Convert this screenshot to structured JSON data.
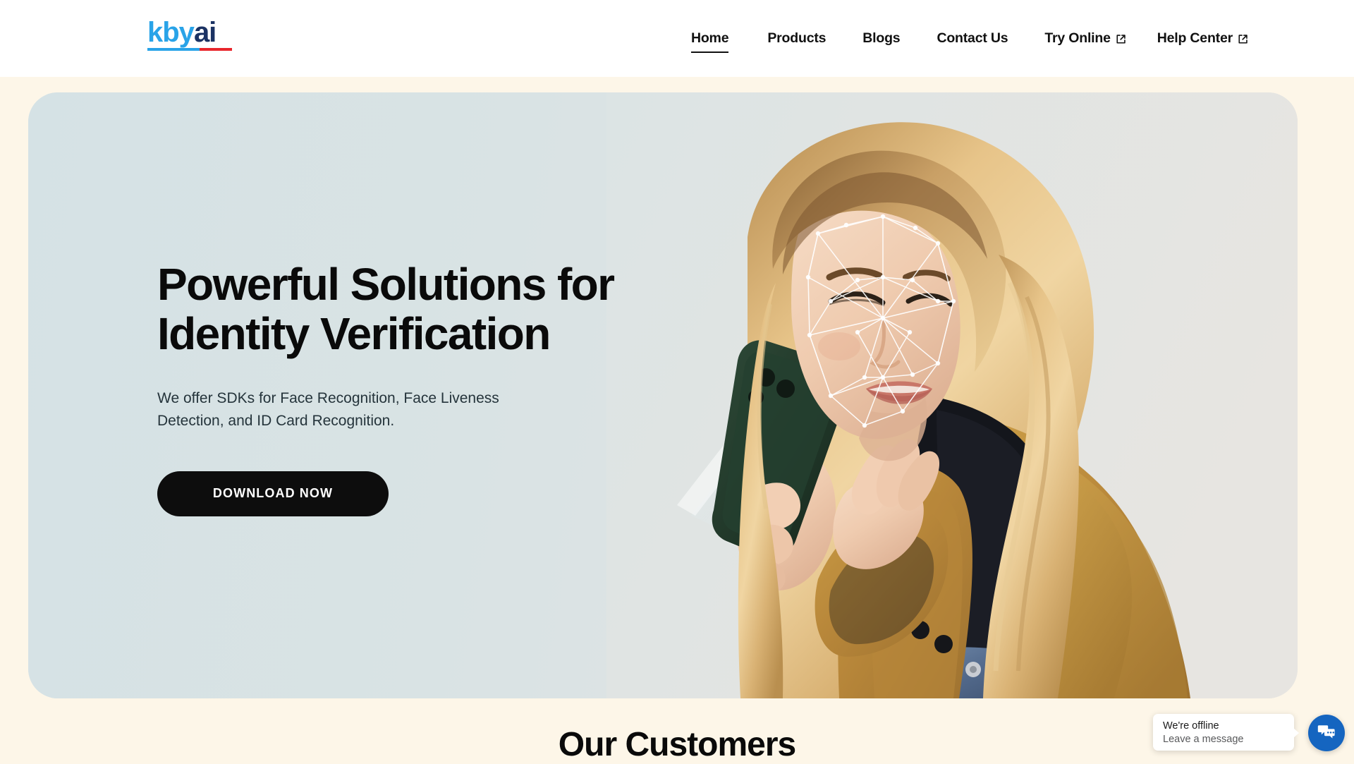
{
  "brand": {
    "logo_primary": "kby",
    "logo_secondary": "ai",
    "color_blue": "#29A3E8",
    "color_navy": "#1B3263",
    "color_red": "#E8262C"
  },
  "nav": {
    "items": [
      {
        "label": "Home",
        "active": true,
        "external": false
      },
      {
        "label": "Products",
        "active": false,
        "external": false
      },
      {
        "label": "Blogs",
        "active": false,
        "external": false
      },
      {
        "label": "Contact Us",
        "active": false,
        "external": false
      },
      {
        "label": "Try Online",
        "active": false,
        "external": true
      },
      {
        "label": "Help Center",
        "active": false,
        "external": true
      }
    ]
  },
  "hero": {
    "title_line1": "Powerful Solutions for",
    "title_line2": "Identity Verification",
    "subtitle": "We offer SDKs for Face Recognition, Face Liveness Detection, and ID Card Recognition.",
    "cta_label": "DOWNLOAD NOW",
    "background_color": "#D9E3E4",
    "cta_background": "#0D0D0D"
  },
  "customers": {
    "title": "Our Customers",
    "background_color": "#FDF6E8"
  },
  "chat_widget": {
    "status_title": "We're offline",
    "status_subtitle": "Leave a message",
    "accent_color": "#1565C0"
  }
}
